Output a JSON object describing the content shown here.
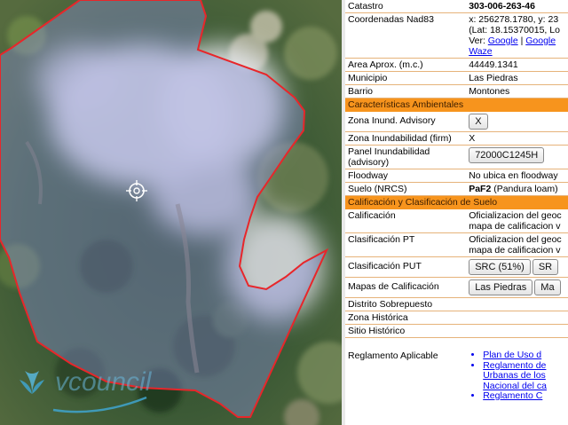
{
  "map": {
    "watermark": "vcouncil",
    "colors": {
      "parcel_outline": "#e8262a",
      "parcel_fill": "#8a8fd6"
    }
  },
  "info": {
    "catastro": {
      "label": "Catastro",
      "value": "303-006-263-46"
    },
    "coordenadas": {
      "label": "Coordenadas Nad83",
      "line1": "x: 256278.1780, y: 23",
      "line2": "(Lat: 18.15370015, Lo",
      "ver_prefix": "Ver:",
      "link_google": "Google",
      "separator": "|",
      "link_google2": "Google",
      "link_waze": "Waze"
    },
    "area": {
      "label": "Area Aprox. (m.c.)",
      "value": "44449.1341"
    },
    "municipio": {
      "label": "Municipio",
      "value": "Las Piedras"
    },
    "barrio": {
      "label": "Barrio",
      "value": "Montones"
    },
    "section_ambientales": "Características Ambientales",
    "zona_inund_advisory": {
      "label": "Zona Inund. Advisory",
      "button": "X"
    },
    "zona_inundabilidad": {
      "label": "Zona Inundabilidad (firm)",
      "value": "X"
    },
    "panel_inundabilidad": {
      "label_line1": "Panel Inundabilidad",
      "label_line2": "(advisory)",
      "button": "72000C1245H"
    },
    "floodway": {
      "label": "Floodway",
      "value": "No ubica en floodway"
    },
    "suelo": {
      "label": "Suelo (NRCS)",
      "code": "PaF2",
      "desc": "(Pandura loam)"
    },
    "section_calificacion": "Calificación y Clasificación de Suelo",
    "calificacion": {
      "label": "Calificación",
      "line1": "Oficializacion del geoc",
      "line2": "mapa de calificacion v"
    },
    "clasificacion_pt": {
      "label": "Clasificación PT",
      "line1": "Oficializacion del geoc",
      "line2": "mapa de calificacion v"
    },
    "clasificacion_put": {
      "label": "Clasificación PUT",
      "button1": "SRC (51%)",
      "button2": "SR"
    },
    "mapas_calificacion": {
      "label": "Mapas de Calificación",
      "button1": "Las Piedras",
      "button2": "Ma"
    },
    "distrito": {
      "label": "Distrito Sobrepuesto"
    },
    "zona_historica": {
      "label": "Zona Histórica"
    },
    "sitio_historico": {
      "label": "Sitio Histórico"
    },
    "reglamento": {
      "label": "Reglamento Aplicable",
      "items": [
        "Plan de Uso d",
        "Reglamento de",
        "Urbanas de los",
        "Nacional del ca",
        "Reglamento C"
      ]
    }
  }
}
